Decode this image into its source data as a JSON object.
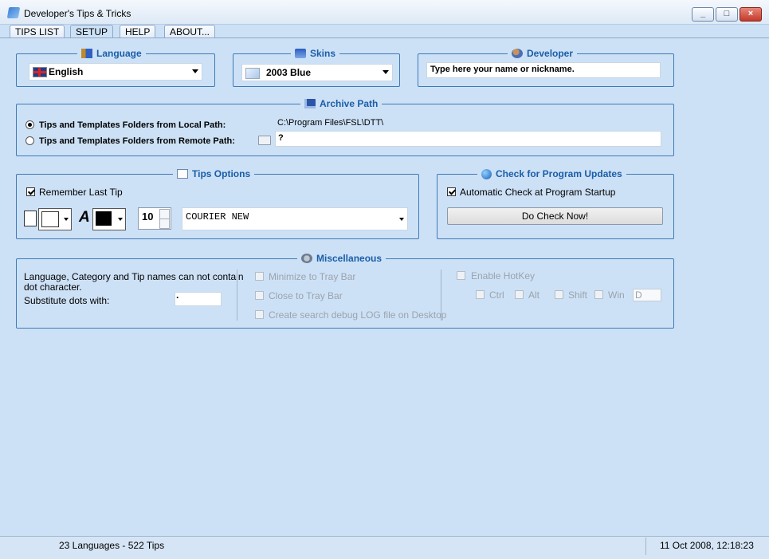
{
  "window": {
    "title": "Developer's Tips & Tricks",
    "minimize_glyph": "_",
    "maximize_glyph": "□",
    "close_glyph": "×"
  },
  "tabs": [
    {
      "label": "TIPS LIST",
      "active": false
    },
    {
      "label": "SETUP",
      "active": true
    },
    {
      "label": "HELP",
      "active": false
    },
    {
      "label": "ABOUT...",
      "active": false
    }
  ],
  "language": {
    "title": "Language",
    "selected": "English",
    "icon": "language-flag-icon"
  },
  "skins": {
    "title": "Skins",
    "selected": "2003 Blue",
    "icon": "monitor-icon"
  },
  "developer": {
    "title": "Developer",
    "placeholder": "Type here your name or nickname.",
    "icon": "user-help-icon"
  },
  "archive": {
    "title": "Archive Path",
    "local_label": "Tips and Templates Folders from Local Path:",
    "local_path": "C:\\Program Files\\FSL\\DTT\\",
    "remote_label": "Tips and Templates Folders from Remote Path:",
    "remote_path": "?",
    "icon": "floppy-disk-icon"
  },
  "tips_options": {
    "title": "Tips Options",
    "remember_label": "Remember Last Tip",
    "remember_checked": true,
    "font_size": "10",
    "font_name": "COURIER NEW",
    "font_glyph": "A",
    "icon": "documents-icon"
  },
  "updates": {
    "title": "Check for Program Updates",
    "auto_label": "Automatic Check at Program Startup",
    "auto_checked": true,
    "check_button": "Do Check Now!",
    "icon": "globe-icon"
  },
  "misc": {
    "title": "Miscellaneous",
    "note_line1": "Language, Category and Tip names can not contain",
    "note_line2": "dot character.",
    "substitute_label": "Substitute dots with:",
    "substitute_value": "·",
    "minimize_tray": "Minimize to Tray Bar",
    "close_tray": "Close to Tray Bar",
    "debug_log": "Create search debug LOG file on Desktop",
    "enable_hotkey": "Enable HotKey",
    "ctrl": "Ctrl",
    "alt": "Alt",
    "shift": "Shift",
    "win": "Win",
    "hotkey_key": "D",
    "icon": "gears-icon"
  },
  "status": {
    "counts": "23 Languages - 522 Tips",
    "datetime": "11 Oct 2008,  12:18:23"
  },
  "colors": {
    "background": "#cde1f6",
    "accent": "#1a5ea8",
    "border": "#3d7ab8"
  }
}
